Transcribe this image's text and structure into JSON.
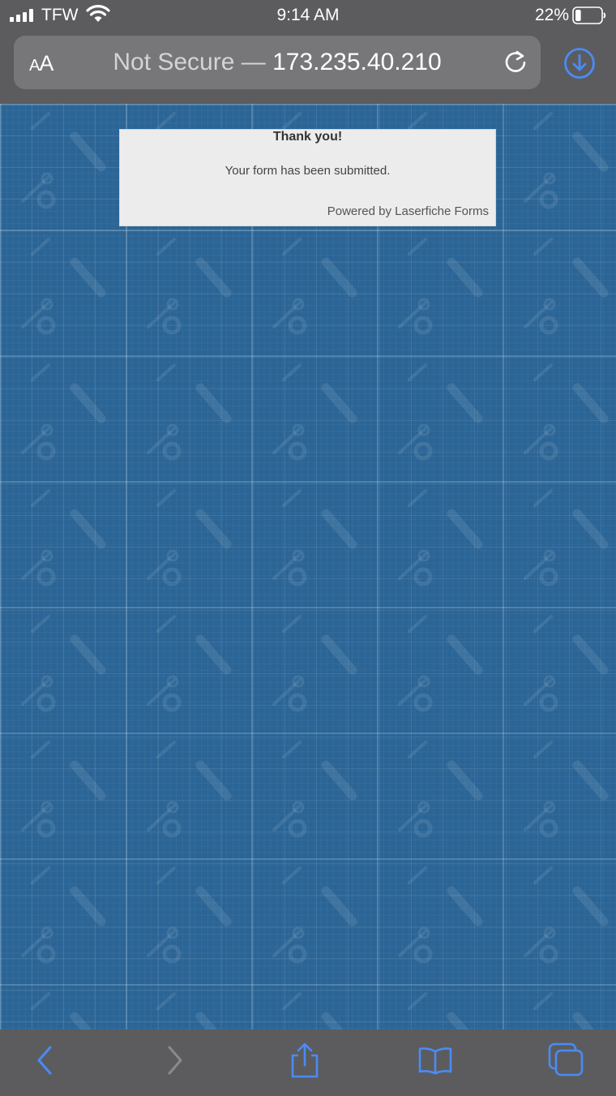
{
  "status_bar": {
    "carrier": "TFW",
    "time": "9:14 AM",
    "battery_percent": "22%",
    "battery_level": 0.22
  },
  "address_bar": {
    "text_size_label": "AA",
    "security_label": "Not Secure —",
    "host": "173.235.40.210"
  },
  "page": {
    "title": "Thank you!",
    "message": "Your form has been submitted.",
    "footer": "Powered by Laserfiche Forms"
  },
  "toolbar": {
    "icons": [
      "back-icon",
      "forward-icon",
      "share-icon",
      "bookmarks-icon",
      "tabs-icon"
    ]
  },
  "colors": {
    "accent": "#4a8bf7",
    "chrome": "#5c5c5e",
    "blueprint": "#2b6596"
  }
}
